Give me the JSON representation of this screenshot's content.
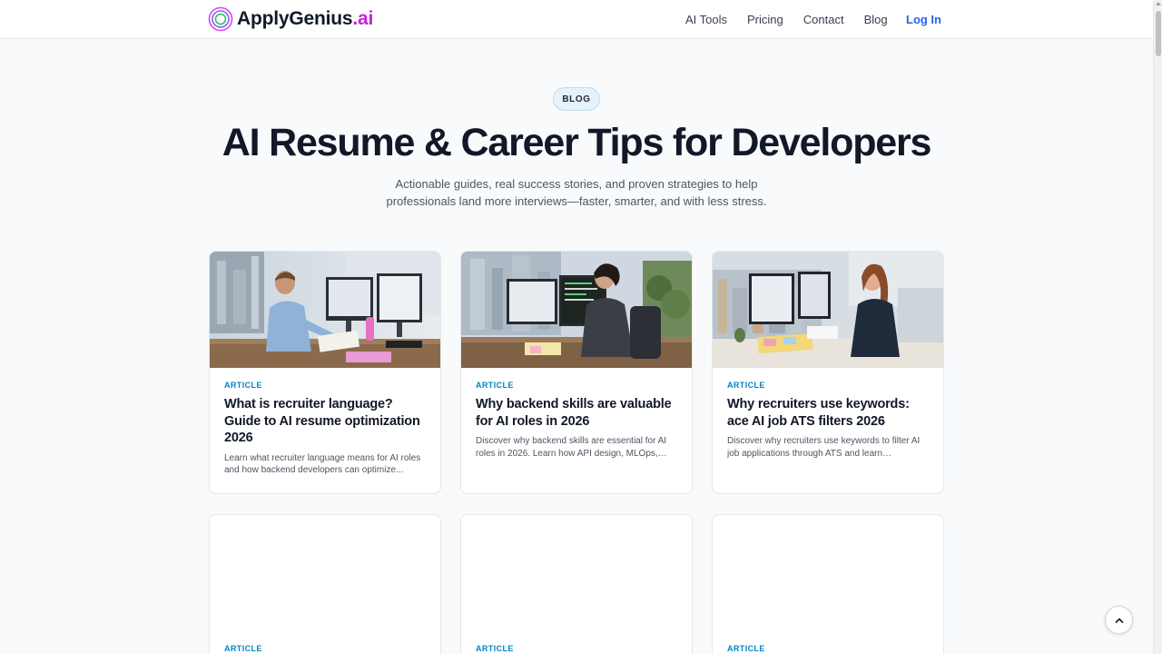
{
  "header": {
    "logo_main": "ApplyGenius",
    "logo_suffix": ".ai",
    "nav": [
      "AI Tools",
      "Pricing",
      "Contact",
      "Blog"
    ],
    "login": "Log In"
  },
  "hero": {
    "badge": "BLOG",
    "title": "AI Resume & Career Tips for Developers",
    "subtitle": "Actionable guides, real success stories, and proven strategies to help professionals land more interviews—faster, smarter, and with less stress."
  },
  "cards": [
    {
      "category": "ARTICLE",
      "title": "What is recruiter language? Guide to AI resume optimization 2026",
      "excerpt": "Learn what recruiter language means for AI roles and how backend developers can optimize..."
    },
    {
      "category": "ARTICLE",
      "title": "Why backend skills are valuable for AI roles in 2026",
      "excerpt": "Discover why backend skills are essential for AI roles in 2026. Learn how API design, MLOps, and..."
    },
    {
      "category": "ARTICLE",
      "title": "Why recruiters use keywords: ace AI job ATS filters 2026",
      "excerpt": "Discover why recruiters use keywords to filter AI job applications through ATS and learn strategies..."
    },
    {
      "category": "ARTICLE"
    },
    {
      "category": "ARTICLE"
    },
    {
      "category": "ARTICLE"
    }
  ],
  "colors": {
    "accent": "#2563eb",
    "category": "#0284c7",
    "brand_suffix": "#c026d3"
  }
}
